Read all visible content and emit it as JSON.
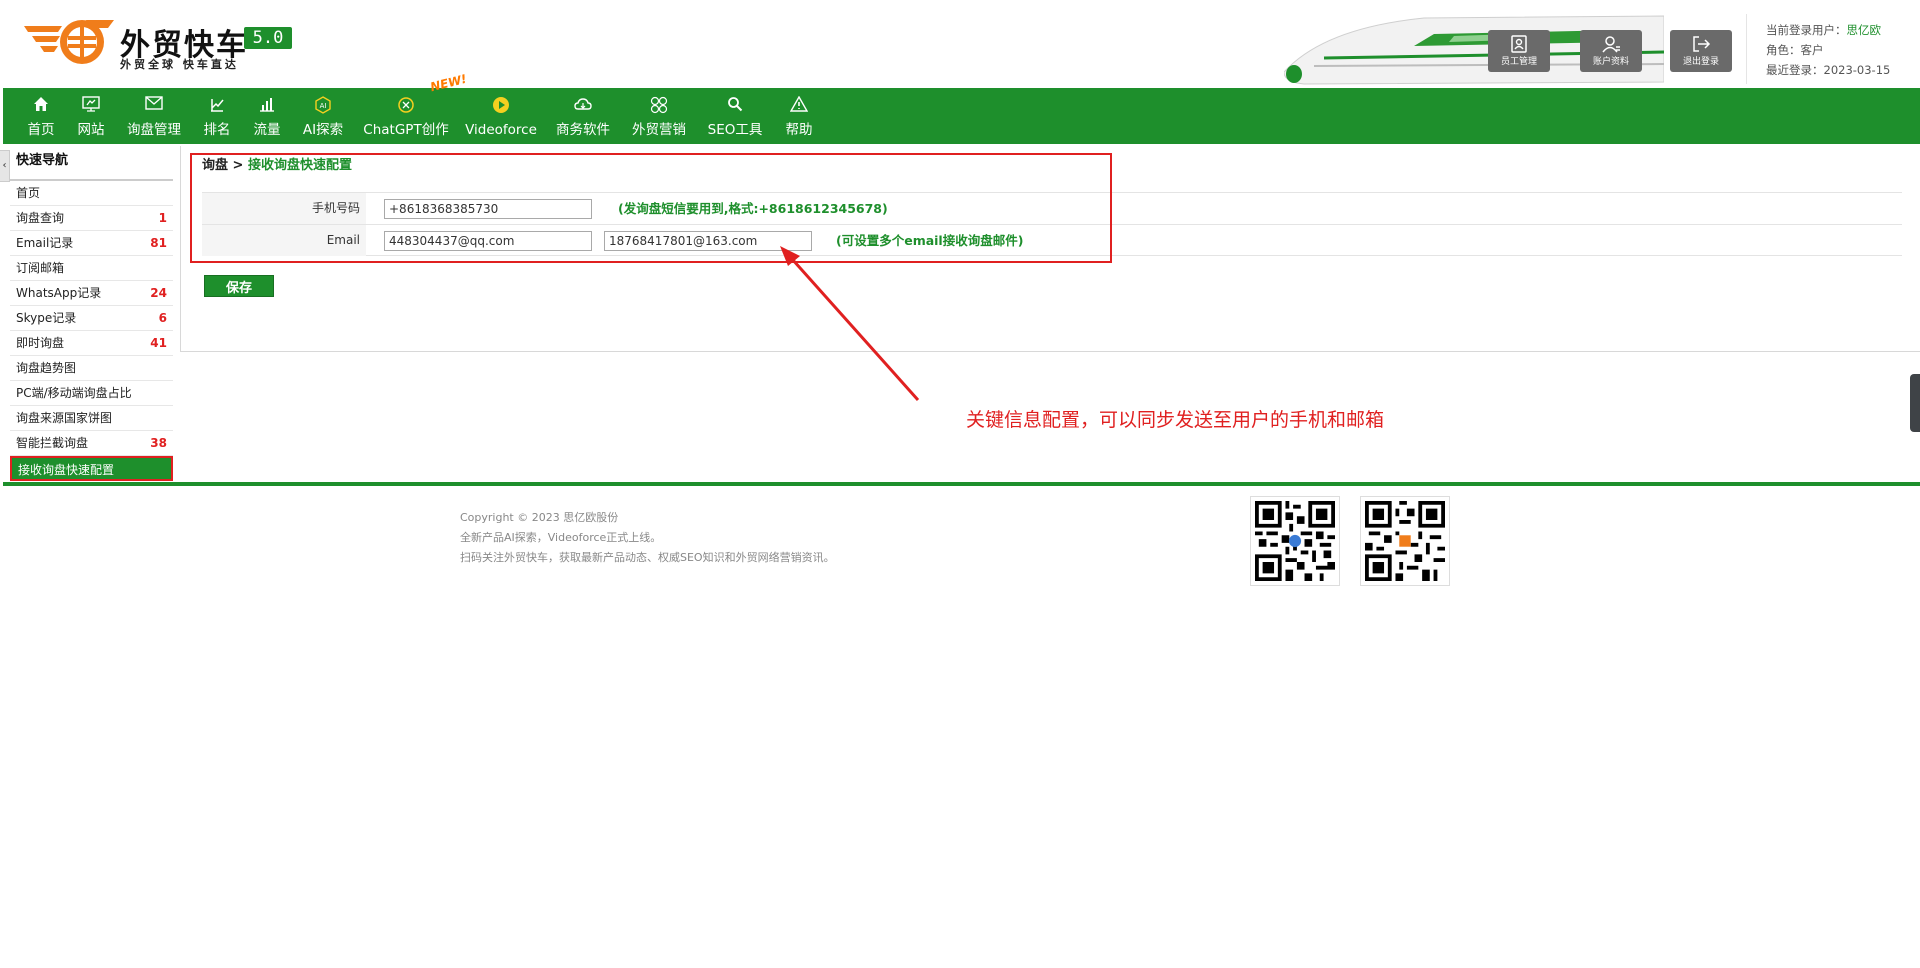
{
  "header": {
    "brand_name": "外贸快车",
    "version": "5.0",
    "slogan": "外贸全球 快车直达",
    "buttons": [
      {
        "label": "员工管理",
        "icon": "staff-icon"
      },
      {
        "label": "账户资料",
        "icon": "account-icon"
      },
      {
        "label": "退出登录",
        "icon": "logout-icon"
      }
    ],
    "user": {
      "current_user_label": "当前登录用户：",
      "current_user": "思亿欧",
      "role_label": "角色：",
      "role": "客户",
      "last_login_label": "最近登录：",
      "last_login": "2023-03-15"
    }
  },
  "nav": {
    "items": [
      {
        "label": "首页",
        "icon": "home-icon"
      },
      {
        "label": "网站",
        "icon": "monitor-icon"
      },
      {
        "label": "询盘管理",
        "icon": "mail-icon"
      },
      {
        "label": "排名",
        "icon": "ranking-icon"
      },
      {
        "label": "流量",
        "icon": "bar-chart-icon"
      },
      {
        "label": "AI探索",
        "icon": "ai-icon"
      },
      {
        "label": "ChatGPT创作",
        "icon": "chatgpt-icon"
      },
      {
        "label": "Videoforce",
        "icon": "video-icon"
      },
      {
        "label": "商务软件",
        "icon": "cloud-icon"
      },
      {
        "label": "外贸营销",
        "icon": "grid-icon"
      },
      {
        "label": "SEO工具",
        "icon": "search-icon"
      },
      {
        "label": "帮助",
        "icon": "warning-icon"
      }
    ],
    "new_badge": "NEW!"
  },
  "sidebar": {
    "title": "快速导航",
    "items": [
      {
        "label": "首页",
        "count": ""
      },
      {
        "label": "询盘查询",
        "count": "1"
      },
      {
        "label": "Email记录",
        "count": "81"
      },
      {
        "label": "订阅邮箱",
        "count": ""
      },
      {
        "label": "WhatsApp记录",
        "count": "24"
      },
      {
        "label": "Skype记录",
        "count": "6"
      },
      {
        "label": "即时询盘",
        "count": "41"
      },
      {
        "label": "询盘趋势图",
        "count": ""
      },
      {
        "label": "PC端/移动端询盘占比",
        "count": ""
      },
      {
        "label": "询盘来源国家饼图",
        "count": ""
      },
      {
        "label": "智能拦截询盘",
        "count": "38"
      },
      {
        "label": "接收询盘快速配置",
        "count": ""
      }
    ]
  },
  "main": {
    "breadcrumb_root": "询盘 > ",
    "breadcrumb_current": "接收询盘快速配置",
    "phone_label": "手机号码",
    "phone_value": "+8618368385730",
    "phone_hint": "(发询盘短信要用到,格式:+8618612345678)",
    "email_label": "Email",
    "email_value_1": "448304437@qq.com",
    "email_value_2": "18768417801@163.com",
    "email_hint": "(可设置多个email接收询盘邮件)",
    "save_label": "保存"
  },
  "annotation": {
    "text": "关键信息配置，可以同步发送至用户的手机和邮箱"
  },
  "footer": {
    "lines": [
      "Copyright © 2023 思亿欧股份",
      "全新产品AI探索，Videoforce正式上线。",
      "扫码关注外贸快车，获取最新产品动态、权威SEO知识和外贸网络营销资讯。"
    ]
  },
  "colors": {
    "brand_green": "#1e8f2c",
    "accent_orange": "#f07d1b",
    "alert_red": "#e02020"
  }
}
